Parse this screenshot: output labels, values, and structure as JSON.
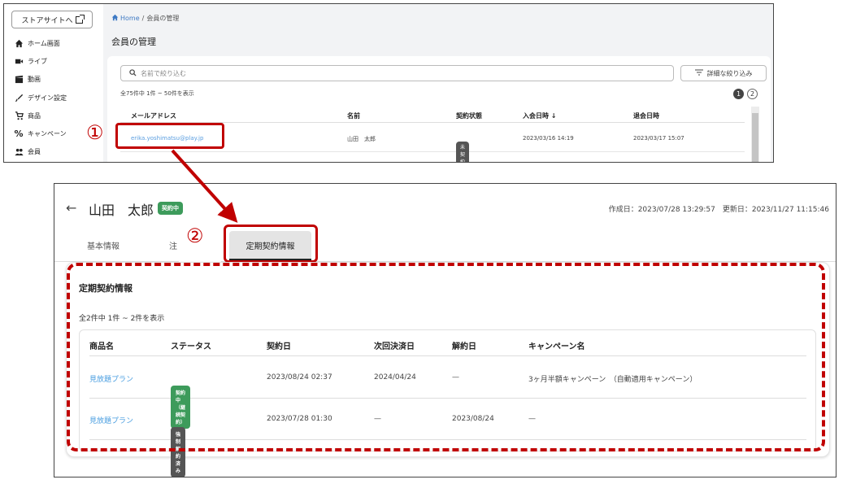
{
  "top": {
    "store_link": "ストアサイトへ",
    "sidebar": [
      {
        "label": "ホーム画面",
        "icon": "home-icon"
      },
      {
        "label": "ライブ",
        "icon": "video-icon"
      },
      {
        "label": "動画",
        "icon": "clapper-icon"
      },
      {
        "label": "デザイン設定",
        "icon": "brush-icon"
      },
      {
        "label": "商品",
        "icon": "cart-icon"
      },
      {
        "label": "キャンペーン",
        "icon": "percent-icon"
      },
      {
        "label": "会員",
        "icon": "people-icon"
      }
    ],
    "breadcrumb_home": "Home",
    "breadcrumb_sep": "/",
    "breadcrumb_current": "会員の管理",
    "page_title": "会員の管理",
    "search_placeholder": "名前で絞り込む",
    "filter_label": "詳細な絞り込み",
    "count_text": "全75件中 1件 ~ 50件を表示",
    "pages": [
      "1",
      "2"
    ],
    "columns": [
      "メールアドレス",
      "名前",
      "契約状態",
      "入会日時 ↓",
      "退会日時"
    ],
    "rows": [
      {
        "email": "erika.yoshimatsu@play.jp",
        "name": "山田　太郎",
        "status": "未契約",
        "joined": "2023/03/16 14:19",
        "left": "2023/03/17 15:07"
      }
    ]
  },
  "annotations": {
    "one": "①",
    "two": "②"
  },
  "bottom": {
    "back": "←",
    "member_name": "山田　太郎",
    "member_status": "契約中",
    "dates": "作成日：2023/07/28 13:29:57　更新日：2023/11/27 11:15:46",
    "tabs": {
      "basic": "基本情報",
      "partial": "注",
      "contract": "定期契約情報"
    },
    "section_title": "定期契約情報",
    "count_text": "全2件中 1件 ~ 2件を表示",
    "columns": [
      "商品名",
      "ステータス",
      "契約日",
      "次回決済日",
      "解約日",
      "キャンペーン名"
    ],
    "rows": [
      {
        "product": "見放題プラン",
        "status": "契約中（継続契約）",
        "status_color": "#3d9b5b",
        "contract_date": "2023/08/24 02:37",
        "next_payment": "2024/04/24",
        "cancel_date": "—",
        "campaign": "3ヶ月半額キャンペーン　（自動適用キャンペーン）"
      },
      {
        "product": "見放題プラン",
        "status": "強制解約済み",
        "status_color": "#555555",
        "contract_date": "2023/07/28 01:30",
        "next_payment": "—",
        "cancel_date": "2023/08/24",
        "campaign": "—"
      }
    ]
  },
  "colors": {
    "accent_red": "#c00000",
    "link_blue": "#4a9ee0",
    "green": "#3d9b5b"
  }
}
